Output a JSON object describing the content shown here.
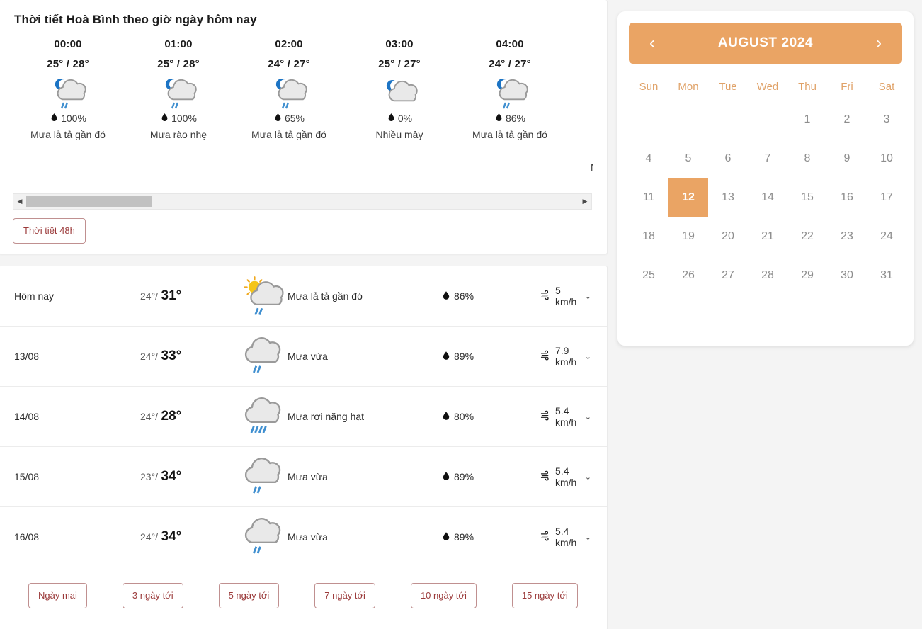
{
  "hourly": {
    "title": "Thời tiết Hoà Bình theo giờ ngày hôm nay",
    "items": [
      {
        "time": "00:00",
        "temp": "25° / 28°",
        "pop": "100%",
        "desc": "Mưa lả tả gần đó",
        "icon": "moon-cloud-rain-icon"
      },
      {
        "time": "01:00",
        "temp": "25° / 28°",
        "pop": "100%",
        "desc": "Mưa rào nhẹ",
        "icon": "moon-cloud-rain-icon"
      },
      {
        "time": "02:00",
        "temp": "24° / 27°",
        "pop": "65%",
        "desc": "Mưa lả tả gần đó",
        "icon": "moon-cloud-rain-icon"
      },
      {
        "time": "03:00",
        "temp": "25° / 27°",
        "pop": "0%",
        "desc": "Nhiều mây",
        "icon": "moon-cloud-icon"
      },
      {
        "time": "04:00",
        "temp": "24° / 27°",
        "pop": "86%",
        "desc": "Mưa lả tả gần đó",
        "icon": "moon-cloud-rain-icon"
      }
    ],
    "button_48h": "Thời tiết 48h",
    "scroll_left_arrow": "◀",
    "scroll_right_arrow": "▶",
    "cutoff_text": "M"
  },
  "daily": {
    "rows": [
      {
        "date": "Hôm nay",
        "low": "24°",
        "sep": "/",
        "high": "31°",
        "cond": "Mưa lả tả gần đó",
        "humidity": "86%",
        "wind": "5 km/h",
        "icon": "sun-cloud-rain-icon"
      },
      {
        "date": "13/08",
        "low": "24°",
        "sep": "/",
        "high": "33°",
        "cond": "Mưa vừa",
        "humidity": "89%",
        "wind": "7.9 km/h",
        "icon": "cloud-rain-icon"
      },
      {
        "date": "14/08",
        "low": "24°",
        "sep": "/",
        "high": "28°",
        "cond": "Mưa rơi nặng hạt",
        "humidity": "80%",
        "wind": "5.4 km/h",
        "icon": "cloud-heavy-rain-icon"
      },
      {
        "date": "15/08",
        "low": "23°",
        "sep": "/",
        "high": "34°",
        "cond": "Mưa vừa",
        "humidity": "89%",
        "wind": "5.4 km/h",
        "icon": "cloud-rain-icon"
      },
      {
        "date": "16/08",
        "low": "24°",
        "sep": "/",
        "high": "34°",
        "cond": "Mưa vừa",
        "humidity": "89%",
        "wind": "5.4 km/h",
        "icon": "cloud-rain-icon"
      }
    ],
    "range_buttons": [
      {
        "label": "Ngày mai"
      },
      {
        "label": "3 ngày tới"
      },
      {
        "label": "5 ngày tới"
      },
      {
        "label": "7 ngày tới"
      },
      {
        "label": "10 ngày tới"
      },
      {
        "label": "15 ngày tới"
      }
    ]
  },
  "calendar": {
    "title": "AUGUST 2024",
    "prev": "‹",
    "next": "›",
    "dow": [
      "Sun",
      "Mon",
      "Tue",
      "Wed",
      "Thu",
      "Fri",
      "Sat"
    ],
    "leading_blanks": 4,
    "days": [
      1,
      2,
      3,
      4,
      5,
      6,
      7,
      8,
      9,
      10,
      11,
      12,
      13,
      14,
      15,
      16,
      17,
      18,
      19,
      20,
      21,
      22,
      23,
      24,
      25,
      26,
      27,
      28,
      29,
      30,
      31
    ],
    "selected_day": 12,
    "accent_color": "#eaa464",
    "dow_color": "#e0a268",
    "day_color": "#8d8d8d"
  },
  "colors": {
    "page_background": "#f4f4f4",
    "card_background": "#ffffff",
    "button_border": "#c09090",
    "button_text": "#9b3a3a",
    "rain_blue": "#3f8fd0",
    "cloud_gray": "#e9e9e9",
    "cloud_stroke": "#9a9a9a",
    "sun_yellow": "#f5c518",
    "moon_blue": "#1c74c4"
  }
}
